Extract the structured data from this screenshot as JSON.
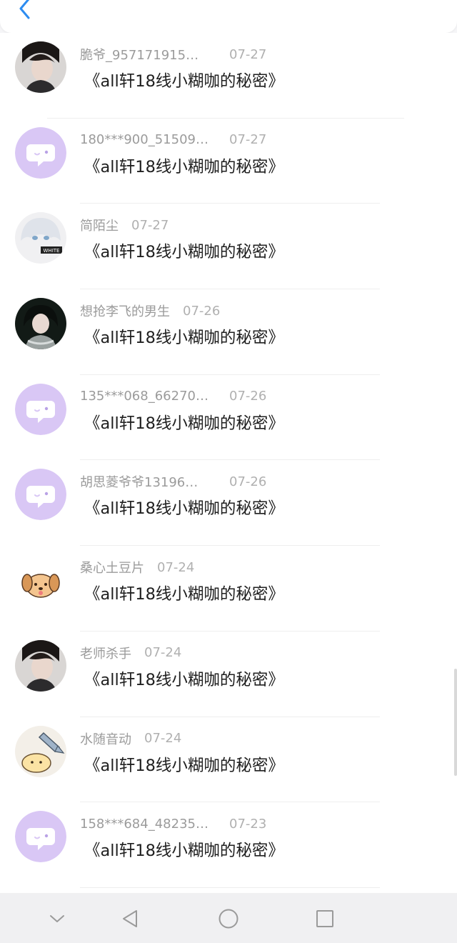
{
  "header": {
    "back_icon": "chevron-left-icon",
    "accent": "#2d8cf0"
  },
  "items": [
    {
      "name": "脆爷_957171915…",
      "date": "07-27",
      "title": "《all轩18线小糊咖的秘密》",
      "avatar": "photo-boy-dark",
      "truncated": true
    },
    {
      "name": "180***900_51509…",
      "date": "07-27",
      "title": "《all轩18线小糊咖的秘密》",
      "avatar": "default-chat-bubble",
      "truncated": true
    },
    {
      "name": "简陌尘",
      "date": "07-27",
      "title": "《all轩18线小糊咖的秘密》",
      "avatar": "photo-anime-white",
      "truncated": false
    },
    {
      "name": "想抢李飞的男生",
      "date": "07-26",
      "title": "《all轩18线小糊咖的秘密》",
      "avatar": "photo-costume",
      "truncated": false
    },
    {
      "name": "135***068_66270…",
      "date": "07-26",
      "title": "《all轩18线小糊咖的秘密》",
      "avatar": "default-chat-bubble",
      "truncated": true
    },
    {
      "name": "胡思菱爷爷13196…",
      "date": "07-26",
      "title": "《all轩18线小糊咖的秘密》",
      "avatar": "default-chat-bubble",
      "truncated": true
    },
    {
      "name": "桑心土豆片",
      "date": "07-24",
      "title": "《all轩18线小糊咖的秘密》",
      "avatar": "cartoon-dog",
      "truncated": false
    },
    {
      "name": "老师杀手",
      "date": "07-24",
      "title": "《all轩18线小糊咖的秘密》",
      "avatar": "photo-boy-dark",
      "truncated": false
    },
    {
      "name": "水随音动",
      "date": "07-24",
      "title": "《all轩18线小糊咖的秘密》",
      "avatar": "cartoon-fish",
      "truncated": false
    },
    {
      "name": "158***684_48235…",
      "date": "07-23",
      "title": "《all轩18线小糊咖的秘密》",
      "avatar": "default-chat-bubble",
      "truncated": true
    }
  ],
  "colors": {
    "avatar_default_bg": "#d9c7f5",
    "name": "#9b9b9b",
    "title": "#1f1f1f"
  },
  "navbar": {
    "icons": [
      "chevron-down-icon",
      "back-triangle-icon",
      "home-circle-icon",
      "recents-square-icon"
    ]
  }
}
